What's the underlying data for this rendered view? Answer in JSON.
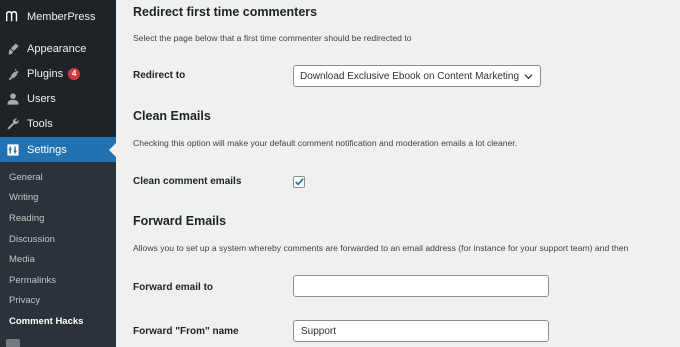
{
  "sidebar": {
    "brand": "MemberPress",
    "items": [
      {
        "label": "Appearance",
        "icon": "paintbrush-icon"
      },
      {
        "label": "Plugins",
        "icon": "plugin-icon",
        "badge": "4"
      },
      {
        "label": "Users",
        "icon": "users-icon"
      },
      {
        "label": "Tools",
        "icon": "wrench-icon"
      },
      {
        "label": "Settings",
        "icon": "settings-icon"
      }
    ],
    "submenu": [
      "General",
      "Writing",
      "Reading",
      "Discussion",
      "Media",
      "Permalinks",
      "Privacy",
      "Comment Hacks"
    ]
  },
  "redirect": {
    "title": "Redirect first time commenters",
    "description": "Select the page below that a first time commenter should be redirected to",
    "label": "Redirect to",
    "selected": "Download Exclusive Ebook on Content Marketing"
  },
  "clean": {
    "title": "Clean Emails",
    "description": "Checking this option will make your default comment notification and moderation emails a lot cleaner.",
    "label": "Clean comment emails",
    "checked": true
  },
  "forward": {
    "title": "Forward Emails",
    "description": "Allows you to set up a system whereby comments are forwarded to an email address (for instance for your support team) and then",
    "email_label": "Forward email to",
    "email_value": "",
    "from_label": "Forward \"From\" name",
    "from_value": "Support"
  },
  "colors": {
    "accent": "#2271b1",
    "sidebar": "#1d2327",
    "badge": "#d63638"
  }
}
